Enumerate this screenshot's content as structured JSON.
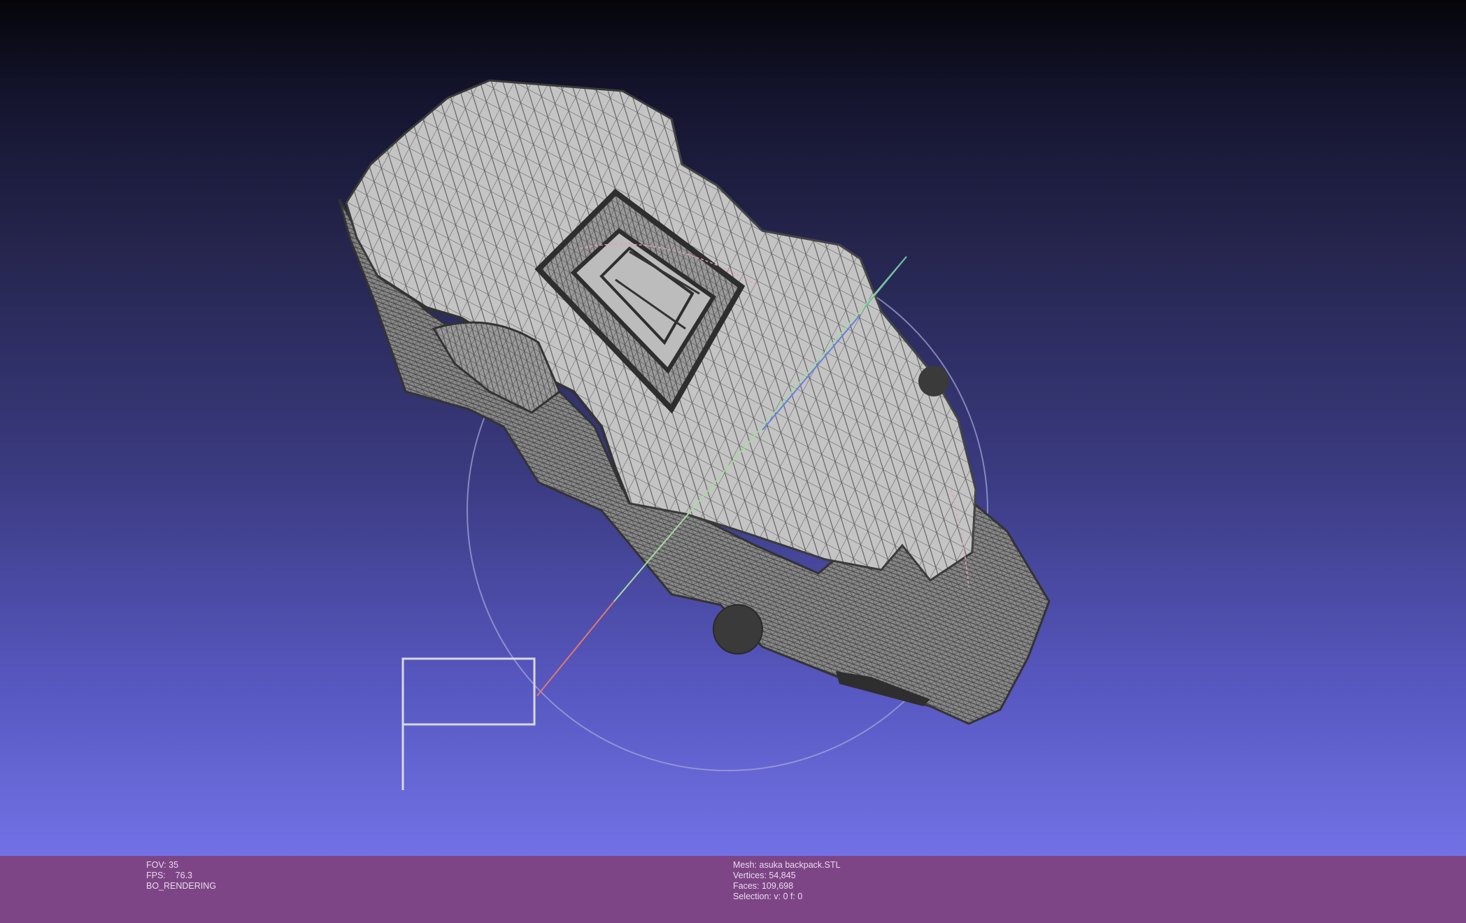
{
  "viewport": {
    "background_top": "#05050a",
    "background_bottom": "#7272e6",
    "mesh_fill": "#bdbdbd",
    "wire_color": "#4a4a4a"
  },
  "status": {
    "background": "#7e4586",
    "left": {
      "fov": "FOV: 35",
      "fps": "FPS:    76.3",
      "mode": "BO_RENDERING"
    },
    "right": {
      "mesh": "Mesh: asuka backpack.STL",
      "vertices": "Vertices: 54,845",
      "faces": "Faces: 109,698",
      "selection": "Selection: v: 0 f: 0"
    }
  }
}
